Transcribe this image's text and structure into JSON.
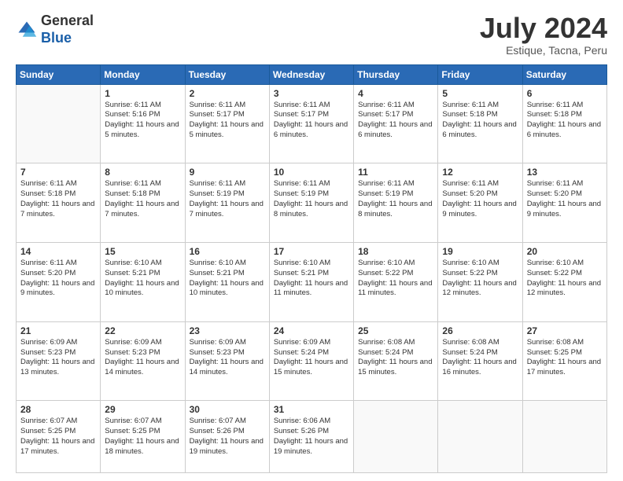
{
  "logo": {
    "general": "General",
    "blue": "Blue"
  },
  "title": "July 2024",
  "location": "Estique, Tacna, Peru",
  "weekdays": [
    "Sunday",
    "Monday",
    "Tuesday",
    "Wednesday",
    "Thursday",
    "Friday",
    "Saturday"
  ],
  "weeks": [
    [
      {
        "day": "",
        "sunrise": "",
        "sunset": "",
        "daylight": ""
      },
      {
        "day": "1",
        "sunrise": "Sunrise: 6:11 AM",
        "sunset": "Sunset: 5:16 PM",
        "daylight": "Daylight: 11 hours and 5 minutes."
      },
      {
        "day": "2",
        "sunrise": "Sunrise: 6:11 AM",
        "sunset": "Sunset: 5:17 PM",
        "daylight": "Daylight: 11 hours and 5 minutes."
      },
      {
        "day": "3",
        "sunrise": "Sunrise: 6:11 AM",
        "sunset": "Sunset: 5:17 PM",
        "daylight": "Daylight: 11 hours and 6 minutes."
      },
      {
        "day": "4",
        "sunrise": "Sunrise: 6:11 AM",
        "sunset": "Sunset: 5:17 PM",
        "daylight": "Daylight: 11 hours and 6 minutes."
      },
      {
        "day": "5",
        "sunrise": "Sunrise: 6:11 AM",
        "sunset": "Sunset: 5:18 PM",
        "daylight": "Daylight: 11 hours and 6 minutes."
      },
      {
        "day": "6",
        "sunrise": "Sunrise: 6:11 AM",
        "sunset": "Sunset: 5:18 PM",
        "daylight": "Daylight: 11 hours and 6 minutes."
      }
    ],
    [
      {
        "day": "7",
        "sunrise": "Sunrise: 6:11 AM",
        "sunset": "Sunset: 5:18 PM",
        "daylight": "Daylight: 11 hours and 7 minutes."
      },
      {
        "day": "8",
        "sunrise": "Sunrise: 6:11 AM",
        "sunset": "Sunset: 5:18 PM",
        "daylight": "Daylight: 11 hours and 7 minutes."
      },
      {
        "day": "9",
        "sunrise": "Sunrise: 6:11 AM",
        "sunset": "Sunset: 5:19 PM",
        "daylight": "Daylight: 11 hours and 7 minutes."
      },
      {
        "day": "10",
        "sunrise": "Sunrise: 6:11 AM",
        "sunset": "Sunset: 5:19 PM",
        "daylight": "Daylight: 11 hours and 8 minutes."
      },
      {
        "day": "11",
        "sunrise": "Sunrise: 6:11 AM",
        "sunset": "Sunset: 5:19 PM",
        "daylight": "Daylight: 11 hours and 8 minutes."
      },
      {
        "day": "12",
        "sunrise": "Sunrise: 6:11 AM",
        "sunset": "Sunset: 5:20 PM",
        "daylight": "Daylight: 11 hours and 9 minutes."
      },
      {
        "day": "13",
        "sunrise": "Sunrise: 6:11 AM",
        "sunset": "Sunset: 5:20 PM",
        "daylight": "Daylight: 11 hours and 9 minutes."
      }
    ],
    [
      {
        "day": "14",
        "sunrise": "Sunrise: 6:11 AM",
        "sunset": "Sunset: 5:20 PM",
        "daylight": "Daylight: 11 hours and 9 minutes."
      },
      {
        "day": "15",
        "sunrise": "Sunrise: 6:10 AM",
        "sunset": "Sunset: 5:21 PM",
        "daylight": "Daylight: 11 hours and 10 minutes."
      },
      {
        "day": "16",
        "sunrise": "Sunrise: 6:10 AM",
        "sunset": "Sunset: 5:21 PM",
        "daylight": "Daylight: 11 hours and 10 minutes."
      },
      {
        "day": "17",
        "sunrise": "Sunrise: 6:10 AM",
        "sunset": "Sunset: 5:21 PM",
        "daylight": "Daylight: 11 hours and 11 minutes."
      },
      {
        "day": "18",
        "sunrise": "Sunrise: 6:10 AM",
        "sunset": "Sunset: 5:22 PM",
        "daylight": "Daylight: 11 hours and 11 minutes."
      },
      {
        "day": "19",
        "sunrise": "Sunrise: 6:10 AM",
        "sunset": "Sunset: 5:22 PM",
        "daylight": "Daylight: 11 hours and 12 minutes."
      },
      {
        "day": "20",
        "sunrise": "Sunrise: 6:10 AM",
        "sunset": "Sunset: 5:22 PM",
        "daylight": "Daylight: 11 hours and 12 minutes."
      }
    ],
    [
      {
        "day": "21",
        "sunrise": "Sunrise: 6:09 AM",
        "sunset": "Sunset: 5:23 PM",
        "daylight": "Daylight: 11 hours and 13 minutes."
      },
      {
        "day": "22",
        "sunrise": "Sunrise: 6:09 AM",
        "sunset": "Sunset: 5:23 PM",
        "daylight": "Daylight: 11 hours and 14 minutes."
      },
      {
        "day": "23",
        "sunrise": "Sunrise: 6:09 AM",
        "sunset": "Sunset: 5:23 PM",
        "daylight": "Daylight: 11 hours and 14 minutes."
      },
      {
        "day": "24",
        "sunrise": "Sunrise: 6:09 AM",
        "sunset": "Sunset: 5:24 PM",
        "daylight": "Daylight: 11 hours and 15 minutes."
      },
      {
        "day": "25",
        "sunrise": "Sunrise: 6:08 AM",
        "sunset": "Sunset: 5:24 PM",
        "daylight": "Daylight: 11 hours and 15 minutes."
      },
      {
        "day": "26",
        "sunrise": "Sunrise: 6:08 AM",
        "sunset": "Sunset: 5:24 PM",
        "daylight": "Daylight: 11 hours and 16 minutes."
      },
      {
        "day": "27",
        "sunrise": "Sunrise: 6:08 AM",
        "sunset": "Sunset: 5:25 PM",
        "daylight": "Daylight: 11 hours and 17 minutes."
      }
    ],
    [
      {
        "day": "28",
        "sunrise": "Sunrise: 6:07 AM",
        "sunset": "Sunset: 5:25 PM",
        "daylight": "Daylight: 11 hours and 17 minutes."
      },
      {
        "day": "29",
        "sunrise": "Sunrise: 6:07 AM",
        "sunset": "Sunset: 5:25 PM",
        "daylight": "Daylight: 11 hours and 18 minutes."
      },
      {
        "day": "30",
        "sunrise": "Sunrise: 6:07 AM",
        "sunset": "Sunset: 5:26 PM",
        "daylight": "Daylight: 11 hours and 19 minutes."
      },
      {
        "day": "31",
        "sunrise": "Sunrise: 6:06 AM",
        "sunset": "Sunset: 5:26 PM",
        "daylight": "Daylight: 11 hours and 19 minutes."
      },
      {
        "day": "",
        "sunrise": "",
        "sunset": "",
        "daylight": ""
      },
      {
        "day": "",
        "sunrise": "",
        "sunset": "",
        "daylight": ""
      },
      {
        "day": "",
        "sunrise": "",
        "sunset": "",
        "daylight": ""
      }
    ]
  ]
}
